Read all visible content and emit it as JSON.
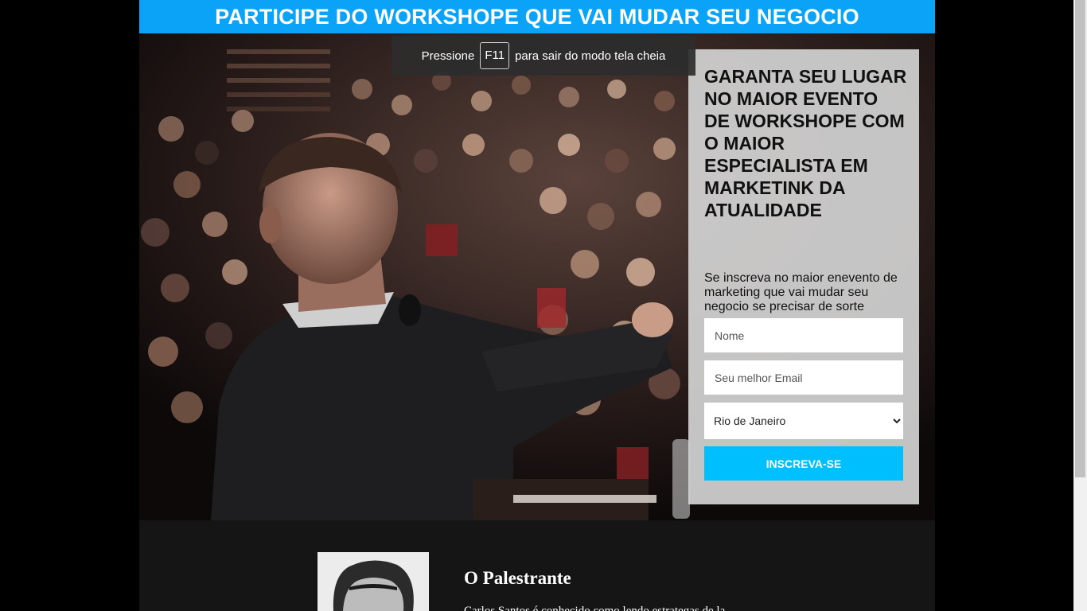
{
  "banner": {
    "title": "PARTICIPE DO WORKSHOPE QUE VAI MUDAR SEU NEGOCIO"
  },
  "fullscreen_notice": {
    "prefix": "Pressione",
    "key": "F11",
    "suffix": "para sair do modo tela cheia"
  },
  "signup_form": {
    "title": "GARANTA SEU LUGAR NO MAIOR EVENTO DE WORKSHOPE COM O MAIOR ESPECIALISTA EM MARKETINK DA ATUALIDADE",
    "subtitle": "Se inscreva no maior enevento de marketing que vai mudar seu negocio se precisar de sorte",
    "name_placeholder": "Nome",
    "email_placeholder": "Seu melhor Email",
    "city_selected": "Rio de Janeiro",
    "submit_label": "INSCREVA-SE"
  },
  "speaker_section": {
    "title": "O Palestrante",
    "description": "Carlos Santos é conhecido como lendo estrategas de la..."
  },
  "colors": {
    "banner_bg": "#0aa3f7",
    "submit_bg": "#00bfff",
    "card_bg": "#d2d2d2",
    "section_bg": "#151515"
  }
}
